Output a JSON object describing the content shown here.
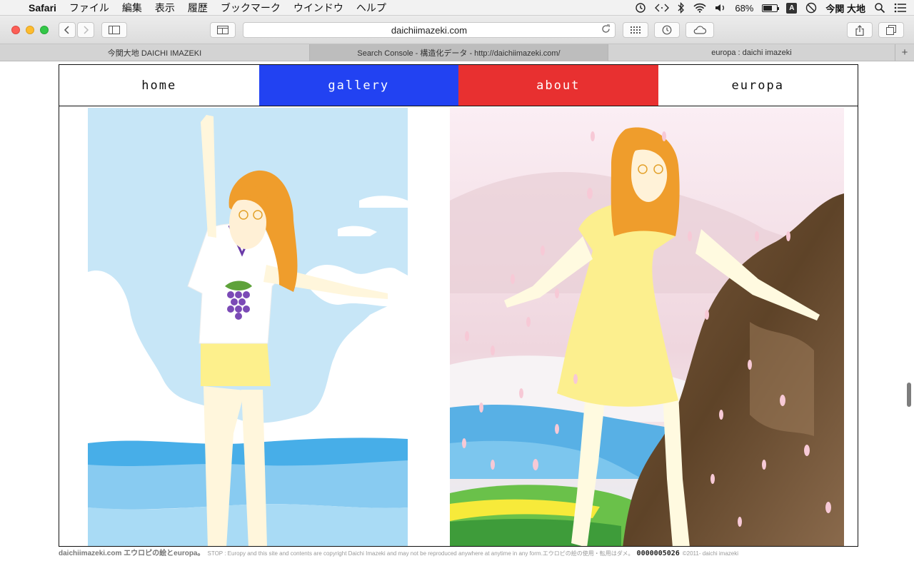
{
  "menubar": {
    "apple_glyph": "",
    "app_name": "Safari",
    "items": [
      "ファイル",
      "編集",
      "表示",
      "履歴",
      "ブックマーク",
      "ウインドウ",
      "ヘルプ"
    ],
    "battery_percent": "68%",
    "battery_level": 0.68,
    "ime_letter": "A",
    "user_name": "今関 大地"
  },
  "browser": {
    "url": "daichiimazeki.com",
    "tabs": [
      {
        "title": "今関大地 DAICHI IMAZEKI",
        "active": false
      },
      {
        "title": "Search Console - 構造化データ - http://daichiimazeki.com/",
        "active": true
      },
      {
        "title": "europa : daichi imazeki",
        "active": false
      }
    ],
    "new_tab_glyph": "+"
  },
  "site": {
    "nav": {
      "home": "home",
      "gallery": "gallery",
      "about": "about",
      "europa": "europa"
    },
    "colors": {
      "gallery": "#2242f2",
      "about": "#e83030"
    },
    "footer": {
      "site_title": "daichiimazeki.com エウロピの絵とeuropa。",
      "notice": "STOP : Europy and this site and contents are copyright Daichi Imazeki and may not be reproduced anywhere at anytime in any form.エウロピの絵の使用・転用はダメ。",
      "counter": "0000005026",
      "copyright": "©2011- daichi imazeki"
    }
  }
}
